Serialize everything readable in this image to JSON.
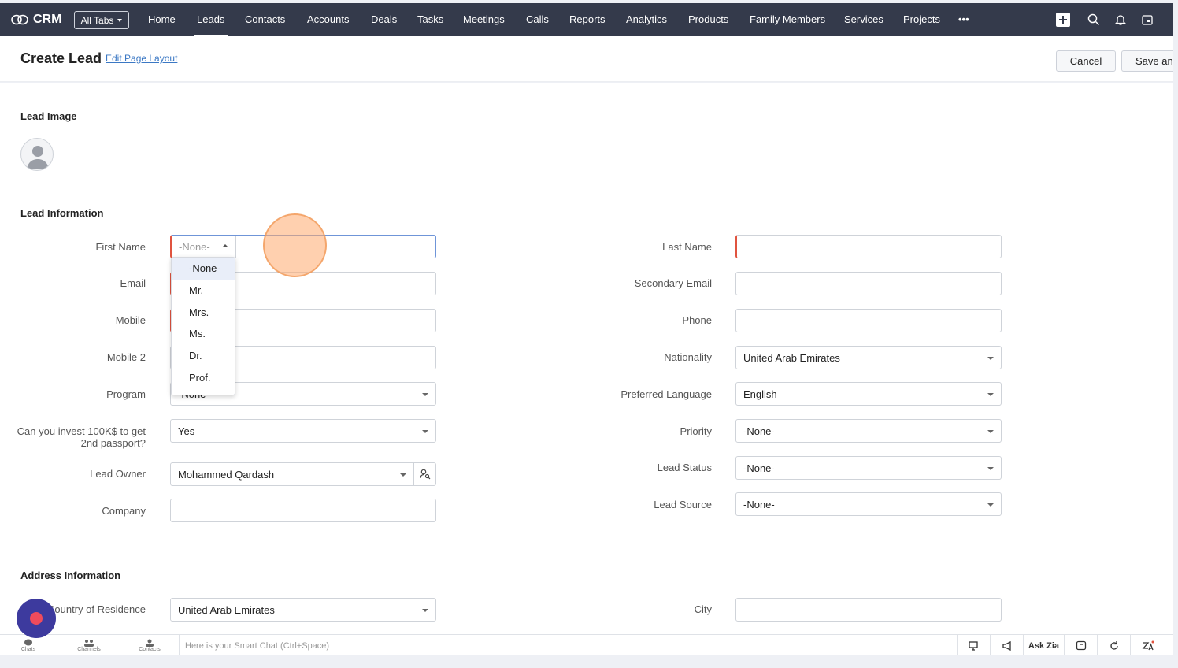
{
  "app": {
    "brand": "CRM",
    "all_tabs": "All Tabs"
  },
  "nav": {
    "items": [
      {
        "label": "Home"
      },
      {
        "label": "Leads"
      },
      {
        "label": "Contacts"
      },
      {
        "label": "Accounts"
      },
      {
        "label": "Deals"
      },
      {
        "label": "Tasks"
      },
      {
        "label": "Meetings"
      },
      {
        "label": "Calls"
      },
      {
        "label": "Reports"
      },
      {
        "label": "Analytics"
      },
      {
        "label": "Products"
      },
      {
        "label": "Family Members"
      },
      {
        "label": "Services"
      },
      {
        "label": "Projects"
      },
      {
        "label": "•••"
      }
    ],
    "active": "Leads",
    "icons": [
      "plus-icon",
      "search-icon",
      "bell-icon",
      "calendar-icon"
    ]
  },
  "header": {
    "title": "Create Lead",
    "edit_layout": "Edit Page Layout",
    "cancel": "Cancel",
    "save": "Save and"
  },
  "sections": {
    "lead_image": "Lead Image",
    "lead_information": "Lead Information",
    "address_information": "Address Information"
  },
  "fields": {
    "first_name": {
      "label": "First Name",
      "salutation": "-None-"
    },
    "last_name": {
      "label": "Last Name",
      "value": ""
    },
    "email": {
      "label": "Email",
      "value": ""
    },
    "secondary_email": {
      "label": "Secondary Email",
      "value": ""
    },
    "mobile": {
      "label": "Mobile",
      "value": ""
    },
    "phone": {
      "label": "Phone",
      "value": ""
    },
    "mobile2": {
      "label": "Mobile 2",
      "value": ""
    },
    "nationality": {
      "label": "Nationality",
      "value": "United Arab Emirates"
    },
    "program": {
      "label": "Program",
      "value": "-None-"
    },
    "preferred_language": {
      "label": "Preferred Language",
      "value": "English"
    },
    "invest": {
      "label_line1": "Can you invest 100K$ to get",
      "label_line2": "2nd passport?",
      "value": "Yes"
    },
    "priority": {
      "label": "Priority",
      "value": "-None-"
    },
    "lead_owner": {
      "label": "Lead Owner",
      "value": "Mohammed Qardash"
    },
    "lead_status": {
      "label": "Lead Status",
      "value": "-None-"
    },
    "company": {
      "label": "Company",
      "value": ""
    },
    "lead_source": {
      "label": "Lead Source",
      "value": "-None-"
    },
    "country_of_residence": {
      "label": "Country of Residence",
      "value": "United Arab Emirates"
    },
    "city": {
      "label": "City",
      "value": ""
    }
  },
  "salutation_options": [
    "-None-",
    "Mr.",
    "Mrs.",
    "Ms.",
    "Dr.",
    "Prof."
  ],
  "bottom": {
    "chats": "Chats",
    "channels": "Channels",
    "contacts": "Contacts",
    "smart_chat_placeholder": "Here is your Smart Chat (Ctrl+Space)",
    "ask_zia": "Ask Zia"
  },
  "colors": {
    "topbar": "#343a4b",
    "mandatory": "#e0533f",
    "link": "#3b78c4",
    "fab": "#3d3a9e"
  }
}
